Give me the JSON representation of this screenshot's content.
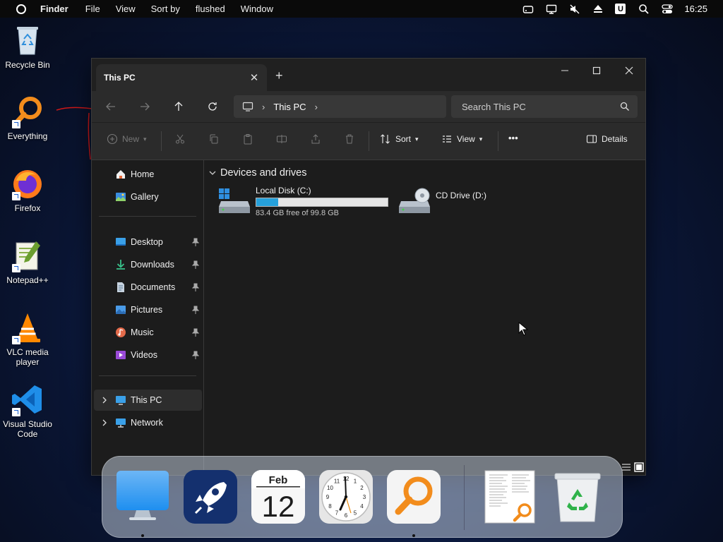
{
  "menubar": {
    "app_name": "Finder",
    "items": [
      "File",
      "View",
      "Sort by",
      "flushed",
      "Window"
    ],
    "user_badge": "U",
    "clock": "16:25"
  },
  "desktop": {
    "icons": [
      {
        "label": "Recycle Bin",
        "icon": "recycle-bin-icon"
      },
      {
        "label": "Everything",
        "icon": "everything-search-icon"
      },
      {
        "label": "Firefox",
        "icon": "firefox-icon"
      },
      {
        "label": "Notepad++",
        "icon": "notepad-plus-plus-icon"
      },
      {
        "label": "VLC media player",
        "icon": "vlc-icon"
      },
      {
        "label": "Visual Studio Code",
        "icon": "vscode-icon"
      }
    ]
  },
  "window": {
    "tab_title": "This PC",
    "address_label": "This PC",
    "search_placeholder": "Search This PC",
    "toolbar": {
      "new_label": "New",
      "sort_label": "Sort",
      "view_label": "View",
      "more_label": "•••",
      "details_label": "Details"
    },
    "sidebar": {
      "top": [
        {
          "label": "Home",
          "icon": "home-icon"
        },
        {
          "label": "Gallery",
          "icon": "gallery-icon"
        }
      ],
      "pinned": [
        {
          "label": "Desktop",
          "icon": "desktop-folder-icon"
        },
        {
          "label": "Downloads",
          "icon": "downloads-icon"
        },
        {
          "label": "Documents",
          "icon": "documents-icon"
        },
        {
          "label": "Pictures",
          "icon": "pictures-icon"
        },
        {
          "label": "Music",
          "icon": "music-icon"
        },
        {
          "label": "Videos",
          "icon": "videos-icon"
        }
      ],
      "tree": [
        {
          "label": "This PC",
          "icon": "this-pc-icon",
          "active": true
        },
        {
          "label": "Network",
          "icon": "network-icon",
          "active": false
        }
      ]
    },
    "content": {
      "section_title": "Devices and drives",
      "drives": [
        {
          "name": "Local Disk (C:)",
          "free_text": "83.4 GB free of 99.8 GB",
          "used_fraction": 0.164
        },
        {
          "name": "CD Drive (D:)"
        }
      ]
    }
  },
  "dock": {
    "items": [
      {
        "name": "finder",
        "icon": "monitor-icon",
        "running": true
      },
      {
        "name": "launchpad",
        "icon": "rocket-icon",
        "running": false
      },
      {
        "name": "calendar",
        "icon": "calendar-icon",
        "month": "Feb",
        "day": "12",
        "running": false
      },
      {
        "name": "clock",
        "icon": "clock-icon",
        "running": false
      },
      {
        "name": "everything",
        "icon": "search-magnifier-icon",
        "running": true
      },
      {
        "name": "document-preview",
        "icon": "document-preview-icon",
        "running": false
      },
      {
        "name": "trash",
        "icon": "trash-icon",
        "running": false
      }
    ]
  },
  "colors": {
    "accent": "#26a0da",
    "window_bg": "#1c1c1c",
    "toolbar_bg": "#2b2b2b"
  }
}
